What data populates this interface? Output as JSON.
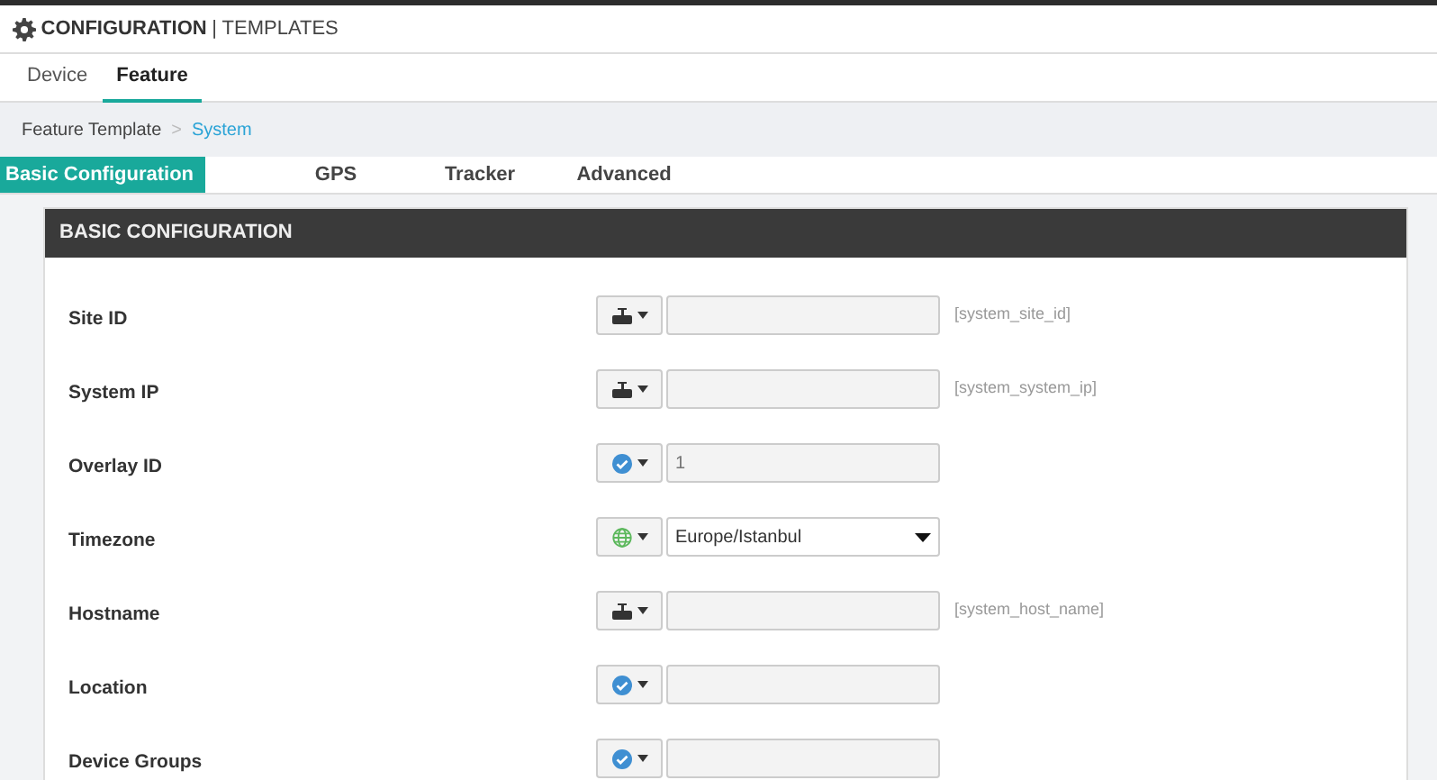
{
  "header": {
    "title": "CONFIGURATION",
    "subtitle": "| TEMPLATES"
  },
  "tabs": [
    {
      "label": "Device",
      "selected": false
    },
    {
      "label": "Feature",
      "selected": true
    }
  ],
  "breadcrumb": {
    "items": [
      "Feature Template",
      "System"
    ],
    "separator": ">"
  },
  "subtabs": [
    {
      "label": "Basic Configuration",
      "selected": true
    },
    {
      "label": "GPS",
      "selected": false
    },
    {
      "label": "Tracker",
      "selected": false
    },
    {
      "label": "Advanced",
      "selected": false
    }
  ],
  "panel": {
    "title": "BASIC CONFIGURATION",
    "fields": [
      {
        "label": "Site ID",
        "kind": "device",
        "hint": "[system_site_id]"
      },
      {
        "label": "System IP",
        "kind": "device",
        "hint": "[system_system_ip]"
      },
      {
        "label": "Overlay ID",
        "kind": "default",
        "placeholder": "1"
      },
      {
        "label": "Timezone",
        "kind": "global",
        "value": "Europe/Istanbul"
      },
      {
        "label": "Hostname",
        "kind": "device",
        "hint": "[system_host_name]"
      },
      {
        "label": "Location",
        "kind": "default"
      },
      {
        "label": "Device Groups",
        "kind": "default"
      }
    ]
  }
}
